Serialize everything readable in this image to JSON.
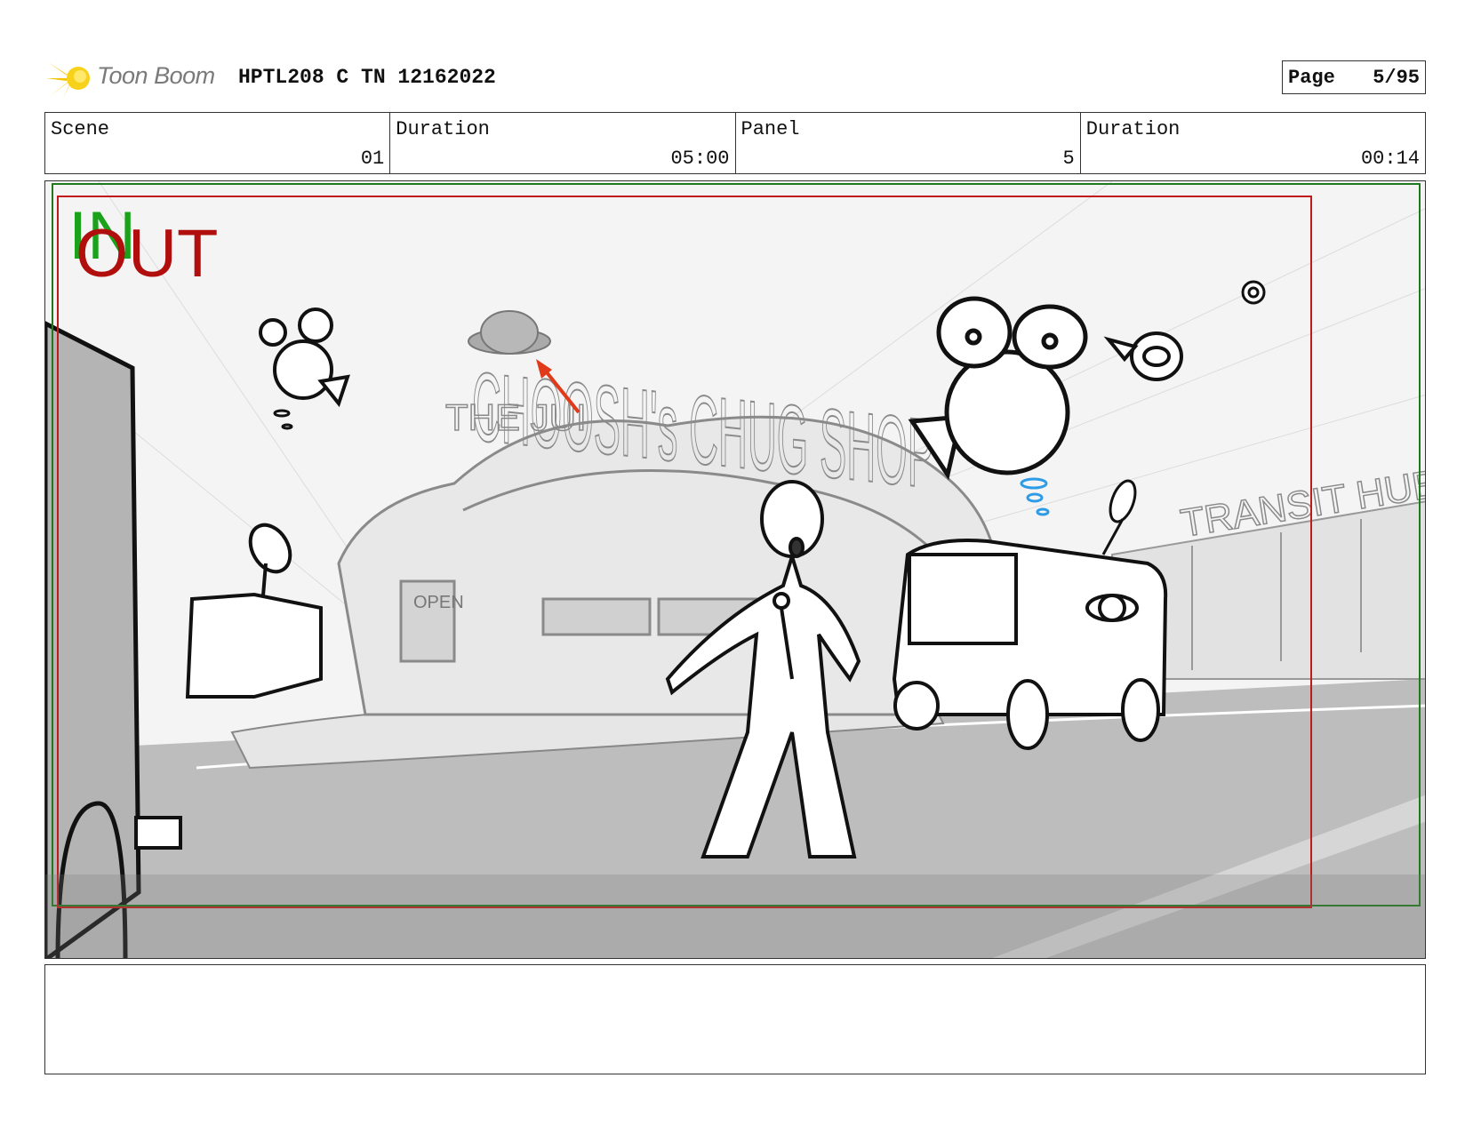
{
  "header": {
    "logo_text": "Toon Boom",
    "project_title": "HPTL208 C TN 12162022",
    "page_label": "Page",
    "page_value": "5/95"
  },
  "info": {
    "scene_label": "Scene",
    "scene_value": "01",
    "scene_duration_label": "Duration",
    "scene_duration_value": "05:00",
    "panel_label": "Panel",
    "panel_value": "5",
    "panel_duration_label": "Duration",
    "panel_duration_value": "00:14"
  },
  "panel_image": {
    "in_marker": "IN",
    "out_marker": "OUT",
    "signs": {
      "shop_sign": "CHOOSH's CHUG SHOP",
      "roof_sign": "THE JUI",
      "transit_sign": "TRANSIT HUB",
      "open_sign": "OPEN"
    },
    "colors": {
      "in_green": "#1aa31a",
      "out_red": "#b10e0e",
      "action_arrow": "#e03a1a",
      "sweat_drops": "#2e9be6"
    }
  },
  "notes": {
    "text": ""
  }
}
